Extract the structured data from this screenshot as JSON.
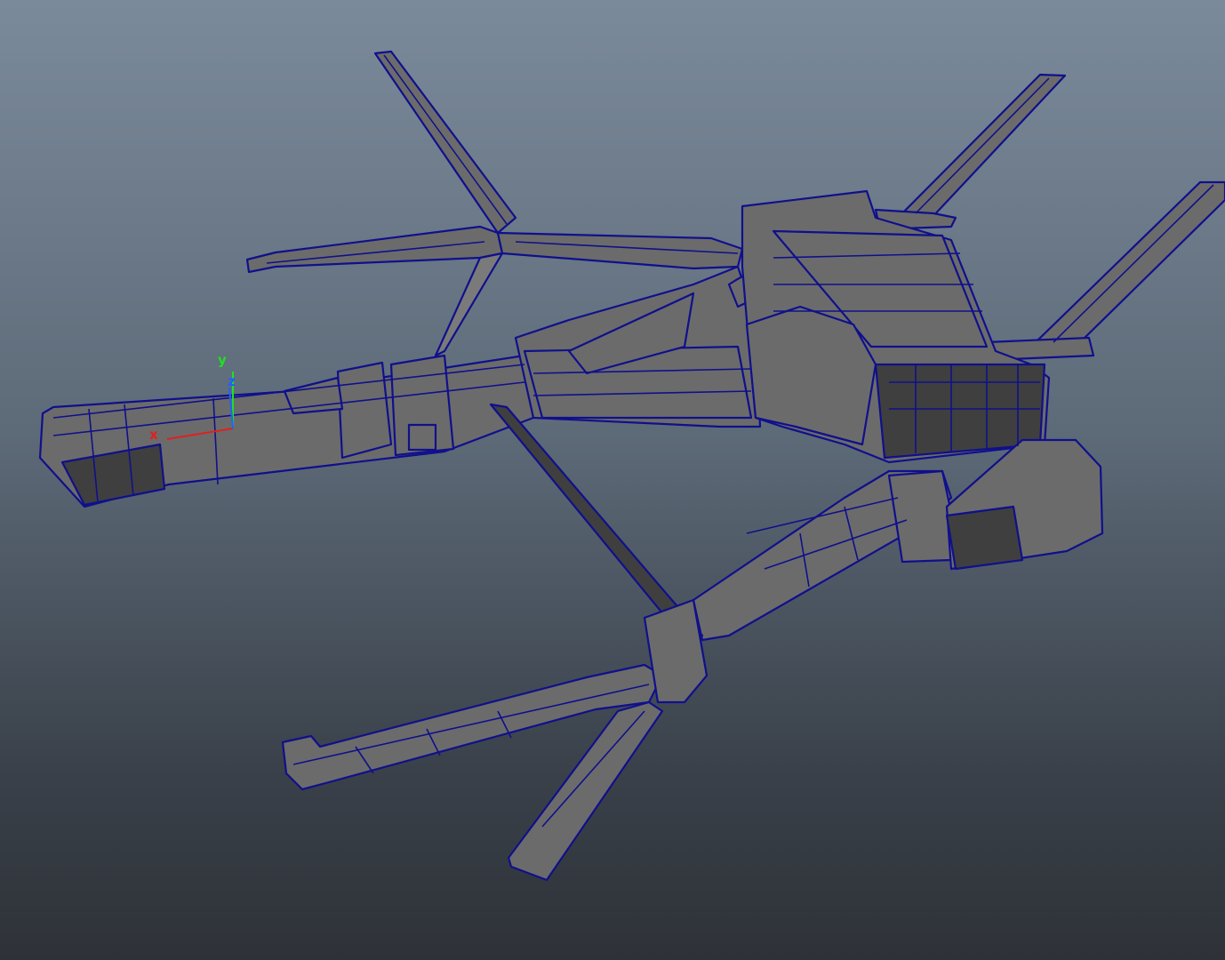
{
  "viewport": {
    "background_top": "#7b8a9b",
    "background_bottom": "#2e3238",
    "mesh_fill": "#6b6b6b",
    "wireframe_color": "#10108c"
  },
  "axis_gizmo": {
    "x_label": "x",
    "y_label": "y",
    "z_label": "z",
    "x_color": "#e02020",
    "y_color": "#20e020",
    "z_color": "#2060ff"
  }
}
